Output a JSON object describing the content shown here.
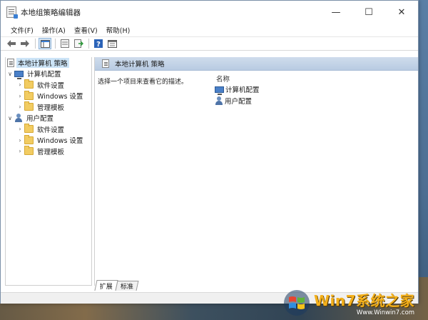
{
  "window": {
    "title": "本地组策略编辑器",
    "controls": {
      "minimize": "—",
      "maximize": "☐",
      "close": "✕"
    }
  },
  "menubar": {
    "items": [
      "文件(F)",
      "操作(A)",
      "查看(V)",
      "帮助(H)"
    ]
  },
  "toolbar": {
    "buttons": [
      "back-arrow-icon",
      "forward-arrow-icon",
      "show-hide-tree-icon",
      "properties-icon",
      "export-list-icon",
      "help-icon",
      "view-icon"
    ]
  },
  "tree": {
    "root": "本地计算机 策略",
    "computer_config": "计算机配置",
    "computer_children": [
      "软件设置",
      "Windows 设置",
      "管理模板"
    ],
    "user_config": "用户配置",
    "user_children": [
      "软件设置",
      "Windows 设置",
      "管理模板"
    ]
  },
  "detail": {
    "header": "本地计算机 策略",
    "description": "选择一个项目来查看它的描述。",
    "column_name": "名称",
    "items": [
      "计算机配置",
      "用户配置"
    ]
  },
  "tabs": {
    "extended": "扩展",
    "standard": "标准"
  },
  "watermark": {
    "brand_main": "Win7系统之家",
    "url": "Www.Winwin7.com"
  },
  "colors": {
    "selection": "#cce4f7",
    "header_band": "#c3d3e7",
    "folder": "#f2cc62",
    "watermark_text": "#f3b01c"
  }
}
